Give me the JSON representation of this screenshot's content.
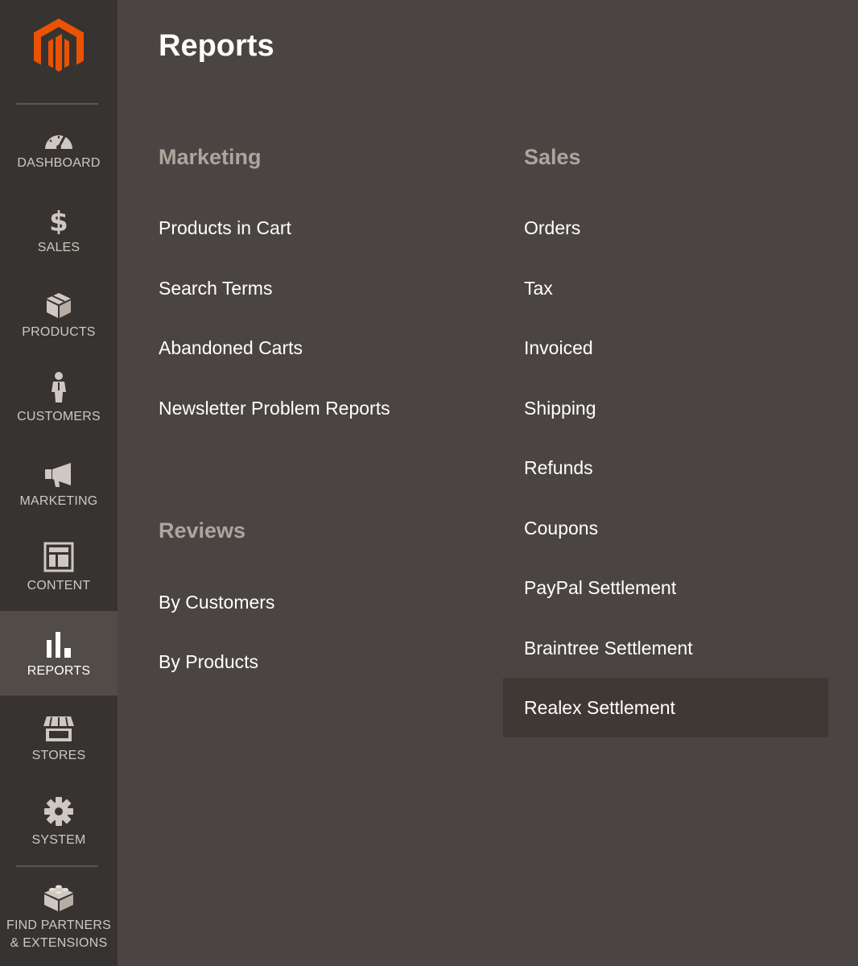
{
  "colors": {
    "background": "#4a4542",
    "sidebar": "#373330",
    "sidebar_active": "#524c48",
    "brand_orange": "#eb5202",
    "group_title": "#ada59e",
    "link": "#ffffff",
    "hover_row": "#3f3834"
  },
  "sidebar": {
    "logo_icon": "magento-logo-icon",
    "items": [
      {
        "label": "DASHBOARD",
        "icon": "speedometer-icon"
      },
      {
        "label": "SALES",
        "icon": "dollar-icon"
      },
      {
        "label": "PRODUCTS",
        "icon": "box-icon"
      },
      {
        "label": "CUSTOMERS",
        "icon": "person-icon"
      },
      {
        "label": "MARKETING",
        "icon": "megaphone-icon"
      },
      {
        "label": "CONTENT",
        "icon": "layout-icon"
      },
      {
        "label": "REPORTS",
        "icon": "bar-chart-icon",
        "active": true
      },
      {
        "label": "STORES",
        "icon": "storefront-icon"
      },
      {
        "label": "SYSTEM",
        "icon": "gear-icon"
      },
      {
        "label": "FIND PARTNERS\n& EXTENSIONS",
        "label_line1": "FIND PARTNERS",
        "label_line2": "& EXTENSIONS",
        "icon": "blocks-icon"
      }
    ]
  },
  "page": {
    "title": "Reports"
  },
  "marketing": {
    "title": "Marketing",
    "links": [
      "Products in Cart",
      "Search Terms",
      "Abandoned Carts",
      "Newsletter Problem Reports"
    ]
  },
  "reviews": {
    "title": "Reviews",
    "links": [
      "By Customers",
      "By Products"
    ]
  },
  "sales": {
    "title": "Sales",
    "links": [
      "Orders",
      "Tax",
      "Invoiced",
      "Shipping",
      "Refunds",
      "Coupons",
      "PayPal Settlement",
      "Braintree Settlement",
      "Realex Settlement"
    ]
  }
}
